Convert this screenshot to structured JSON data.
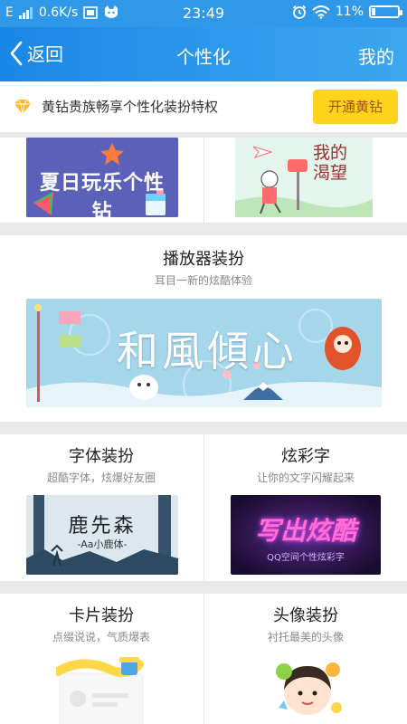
{
  "status_bar": {
    "network": "E",
    "speed": "0.6K/s",
    "time": "23:49",
    "battery": "11%"
  },
  "nav": {
    "back_label": "返回",
    "title": "个性化",
    "right_label": "我的"
  },
  "promo": {
    "text": "黄钻贵族畅享个性化装扮特权",
    "button_label": "开通黄钻"
  },
  "top_cards": {
    "left_banner_text": "夏日玩乐个性钻",
    "right_banner_text": "我的渴望"
  },
  "player": {
    "title": "播放器装扮",
    "subtitle": "耳目一新的炫酷体验",
    "banner_text": "和風傾心"
  },
  "font_section": {
    "title": "字体装扮",
    "subtitle": "超酷字体，炫爆好友圈",
    "thumb_main": "鹿先森",
    "thumb_sub": "-Aa小鹿体-"
  },
  "color_text_section": {
    "title": "炫彩字",
    "subtitle": "让你的文字闪耀起来",
    "thumb_main": "写出炫酷",
    "thumb_sub": "QQ空间个性炫彩字"
  },
  "card_section": {
    "title": "卡片装扮",
    "subtitle": "点缀说说，气质爆表"
  },
  "avatar_section": {
    "title": "头像装扮",
    "subtitle": "衬托最美的头像"
  }
}
